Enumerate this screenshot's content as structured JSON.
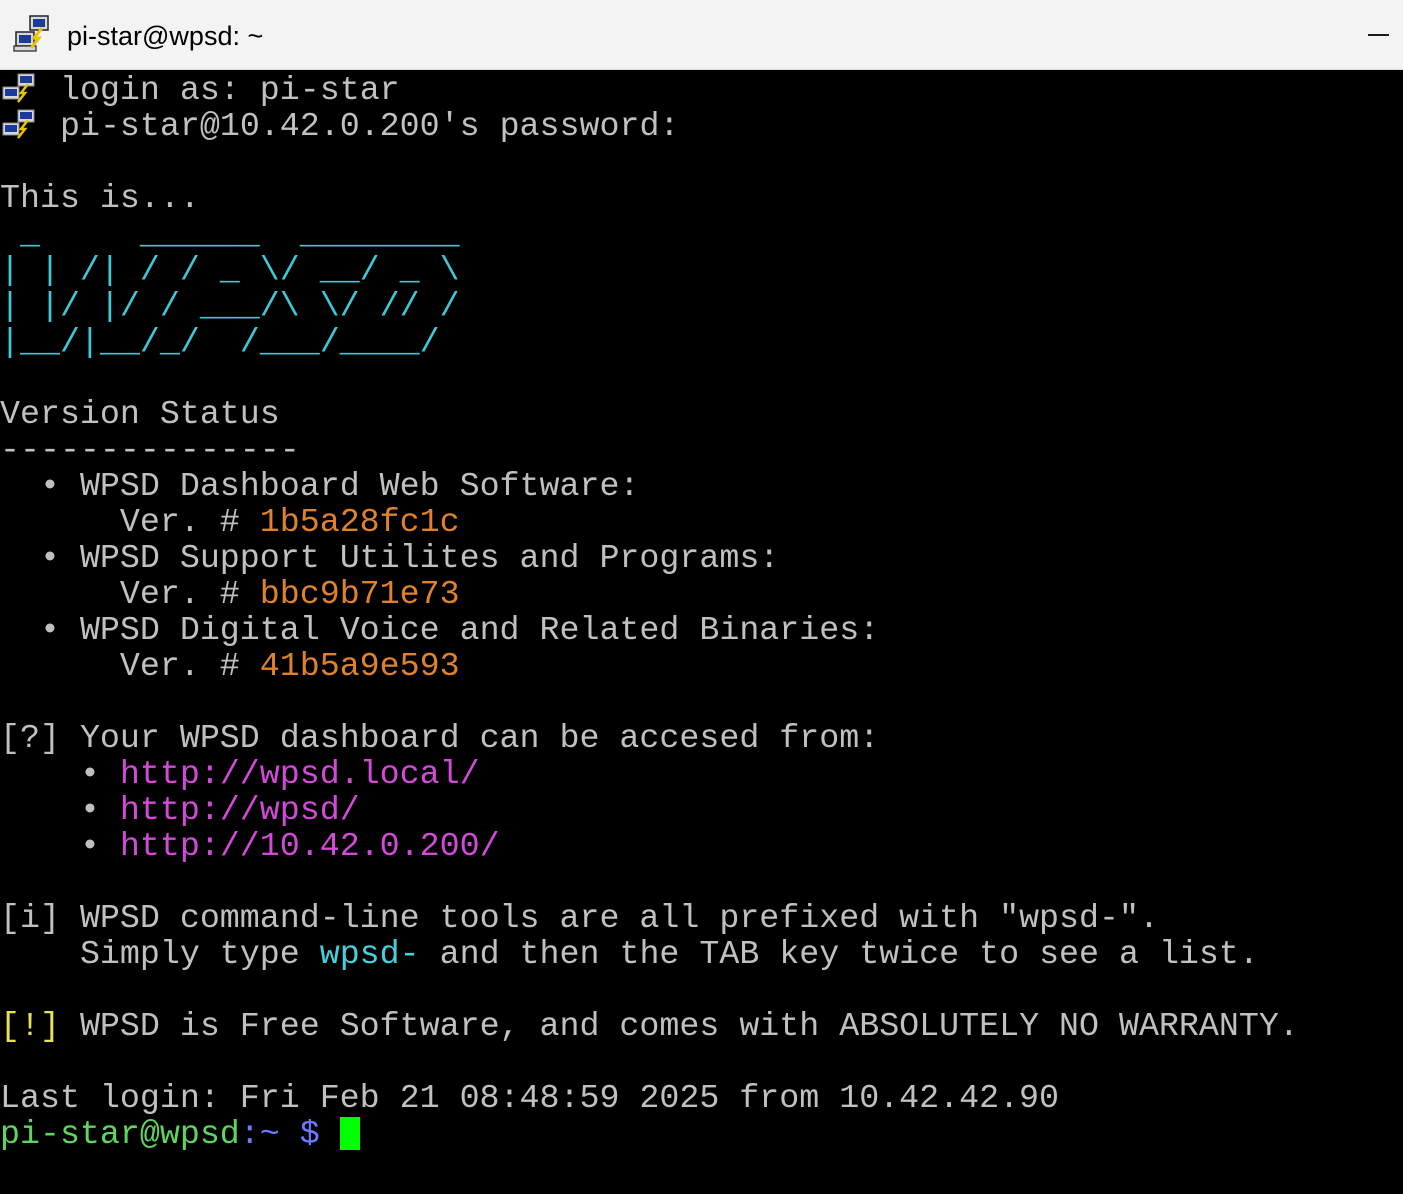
{
  "window": {
    "title": "pi-star@wpsd: ~",
    "app_icon": "putty-icon",
    "minimize_icon": "minimize-icon"
  },
  "session": {
    "login_prompt": "login as: pi-star",
    "password_prompt": "pi-star@10.42.0.200's password:"
  },
  "banner": {
    "intro": "This is...",
    "ascii_art": [
      " _     ______  ________",
      "| | /| / / _ \\/ __/ _ \\",
      "| |/ |/ / ___/\\ \\/ // /",
      "|__/|__/_/  /___/____/"
    ]
  },
  "version_status": {
    "heading": "Version Status",
    "rule": "---------------",
    "items": [
      {
        "bullet": "•",
        "name": "WPSD Dashboard Web Software:",
        "ver_label": "Ver. #",
        "hash": "1b5a28fc1c"
      },
      {
        "bullet": "•",
        "name": "WPSD Support Utilites and Programs:",
        "ver_label": "Ver. #",
        "hash": "bbc9b71e73"
      },
      {
        "bullet": "•",
        "name": "WPSD Digital Voice and Related Binaries:",
        "ver_label": "Ver. #",
        "hash": "41b5a9e593"
      }
    ]
  },
  "dashboard_info": {
    "tag": "[?]",
    "text": "Your WPSD dashboard can be accesed from:",
    "urls": [
      {
        "bullet": "•",
        "url": "http://wpsd.local/"
      },
      {
        "bullet": "•",
        "url": "http://wpsd/"
      },
      {
        "bullet": "•",
        "url": "http://10.42.0.200/"
      }
    ]
  },
  "tools_info": {
    "tag": "[i]",
    "line1": "WPSD command-line tools are all prefixed with \"wpsd-\".",
    "line2_prefix": "Simply type",
    "line2_cmd": "wpsd-",
    "line2_suffix": "and then the TAB key twice to see a list."
  },
  "warranty": {
    "tag": "[!]",
    "text": "WPSD is Free Software, and comes with ABSOLUTELY NO WARRANTY."
  },
  "last_login": "Last login: Fri Feb 21 08:48:59 2025 from 10.42.42.90",
  "prompt": {
    "user_host": "pi-star@wpsd",
    "path": ":~",
    "symbol": "$"
  },
  "colors": {
    "background": "#000000",
    "text": "#c0c0c0",
    "ascii_art": "#3ec9d9",
    "hash": "#e0822b",
    "url": "#d44ad8",
    "command": "#45d1d9",
    "warning_tag": "#e6e25a",
    "prompt_user": "#5fd45f",
    "prompt_symbol": "#6c7bff",
    "cursor": "#00ff00"
  }
}
